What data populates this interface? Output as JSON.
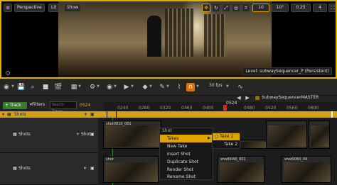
{
  "viewport": {
    "perspective_label": "Perspective",
    "lit_label": "Lit",
    "show_label": "Show",
    "level_label": "Level: subwaySequencer_P (Persistent)",
    "right_values": [
      "10",
      "10°",
      "0.25",
      "4"
    ]
  },
  "toolbar": {
    "fps_label": "30 fps",
    "sequence_name": "SubwaySequencerMASTER"
  },
  "sequencer": {
    "track_button": "+ Track",
    "filters_label": "Filters",
    "search_placeholder": "Search Tracks",
    "current_frame": "0524",
    "playhead_frame": "0524",
    "ruler_ticks": [
      "0240",
      "0280",
      "0320",
      "0360",
      "0400",
      "0440",
      "0480",
      "0520",
      "0560",
      "0600",
      "0640",
      "0680"
    ],
    "shots_track_label": "Shots",
    "track_rows": [
      {
        "label": "Shots",
        "add_label": "Shot"
      },
      {
        "label": "Shots",
        "add_label": ""
      }
    ],
    "clips": [
      {
        "label": "shot0010_001"
      },
      {
        "label": "shot0020_001"
      },
      {
        "label": "shot0040_001"
      },
      {
        "label": "shot0050_001"
      }
    ],
    "partial_labels": [
      "shot",
      "shot0060_00"
    ]
  },
  "context_menu": {
    "header": "Shot",
    "items": [
      "Takes",
      "New Take",
      "Insert Shot",
      "Duplicate Shot",
      "Render Shot",
      "Rename Shot"
    ],
    "takes_submenu": [
      "Take 1",
      "Take 2"
    ]
  },
  "colors": {
    "accent": "#d4a017",
    "menu_highlight": "#e0a400",
    "add_track_green": "#3c7a2e",
    "viewport_border": "#e0b000"
  }
}
